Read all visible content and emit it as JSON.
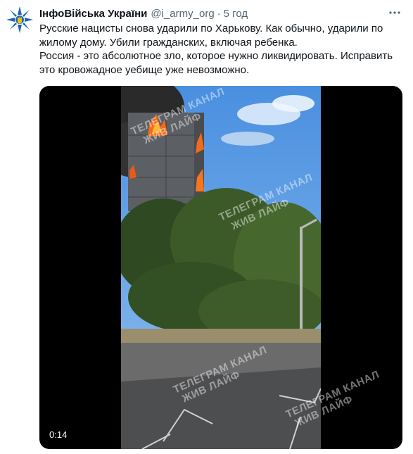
{
  "tweet": {
    "author_name": "ІнфоВійська України",
    "author_handle": "@i_army_org",
    "separator": "·",
    "time": "5 год",
    "text_lines": [
      "Русские нацисты снова ударили по Харькову. Как обычно, ударили по",
      "жилому дому. Убили гражданских, включая ребенка.",
      "Россия - это абсолютное зло, которое нужно ликвидировать. Исправить",
      "это кровожадное уебище уже невозможно."
    ]
  },
  "video": {
    "duration": "0:14",
    "watermarks": [
      "ТЕЛЕГРАМ КАНАЛ",
      "ЖИВ ЛАЙФ",
      "ТЕЛЕГРАМ КАНАЛ",
      "ЖИВ ЛАЙФ",
      "ТЕЛЕГРАМ КАНАЛ",
      "ЖИВ ЛАЙФ",
      "ТЕЛЕГРАМ КАНАЛ",
      "ЖИВ ЛАЙФ"
    ]
  },
  "icons": {
    "avatar": "emblem-icon",
    "more": "more-horizontal-icon"
  },
  "colors": {
    "text": "#0f1419",
    "secondary": "#536471",
    "avatar_blue": "#1d64b8"
  }
}
